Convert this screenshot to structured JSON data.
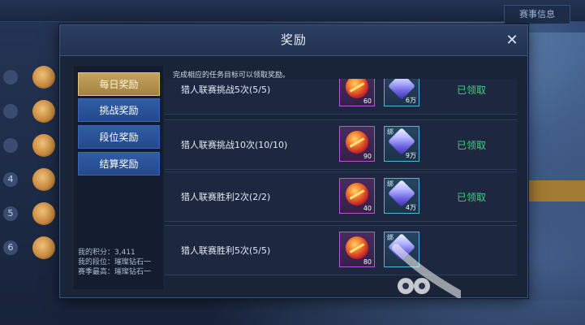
{
  "background": {
    "top_right_label": "赛事信息",
    "ranks": [
      "",
      "",
      "",
      "4",
      "5",
      "6"
    ]
  },
  "dialog": {
    "title": "奖励",
    "close_icon": "close-icon"
  },
  "tabs": [
    {
      "label": "每日奖励",
      "active": true
    },
    {
      "label": "挑战奖励",
      "active": false
    },
    {
      "label": "段位奖励",
      "active": false
    },
    {
      "label": "结算奖励",
      "active": false
    }
  ],
  "stats": {
    "points": "我的积分：3,411",
    "rank": "我的段位：璀璨钻石一",
    "season_best": "赛季最高：璀璨钻石一"
  },
  "hint": "完成相应的任务目标可以领取奖励。",
  "tasks": [
    {
      "name": "猎人联赛挑战5次(5/5)",
      "reward1_qty": "60",
      "reward2_qty": "6万",
      "status": "已领取"
    },
    {
      "name": "猎人联赛挑战10次(10/10)",
      "reward1_qty": "90",
      "reward2_qty": "9万",
      "status": "已领取"
    },
    {
      "name": "猎人联赛胜利2次(2/2)",
      "reward1_qty": "40",
      "reward2_qty": "4万",
      "status": "已领取"
    },
    {
      "name": "猎人联赛胜利5次(5/5)",
      "reward1_qty": "80",
      "reward2_qty": "",
      "status": ""
    }
  ],
  "item_tag": "绑",
  "colors": {
    "active_tab": "#c3a460",
    "tab": "#2f5da7",
    "claimed": "#3ed17a"
  }
}
